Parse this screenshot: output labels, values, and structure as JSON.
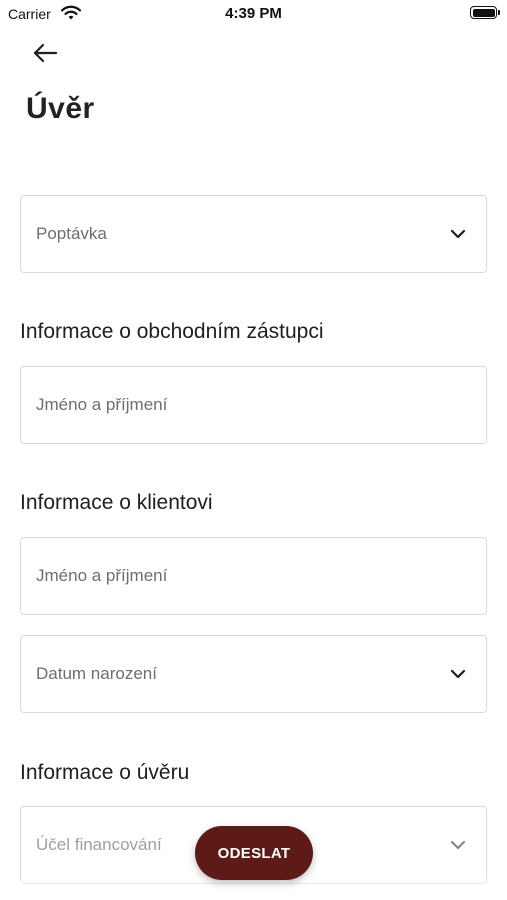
{
  "status_bar": {
    "carrier": "Carrier",
    "time": "4:39 PM"
  },
  "header": {
    "title": "Úvěr"
  },
  "form": {
    "request_type": {
      "label": "Poptávka"
    },
    "agent_section": {
      "heading": "Informace o obchodním zástupci",
      "name_placeholder": "Jméno a příjmení"
    },
    "client_section": {
      "heading": "Informace o klientovi",
      "name_placeholder": "Jméno a příjmení",
      "birth_date_label": "Datum narození"
    },
    "loan_section": {
      "heading": "Informace o úvěru",
      "purpose_label": "Účel financování"
    }
  },
  "actions": {
    "submit_label": "ODESLAT"
  },
  "colors": {
    "accent": "#5e1a16",
    "border": "#d9d9d9",
    "placeholder": "#6e6e6e"
  }
}
